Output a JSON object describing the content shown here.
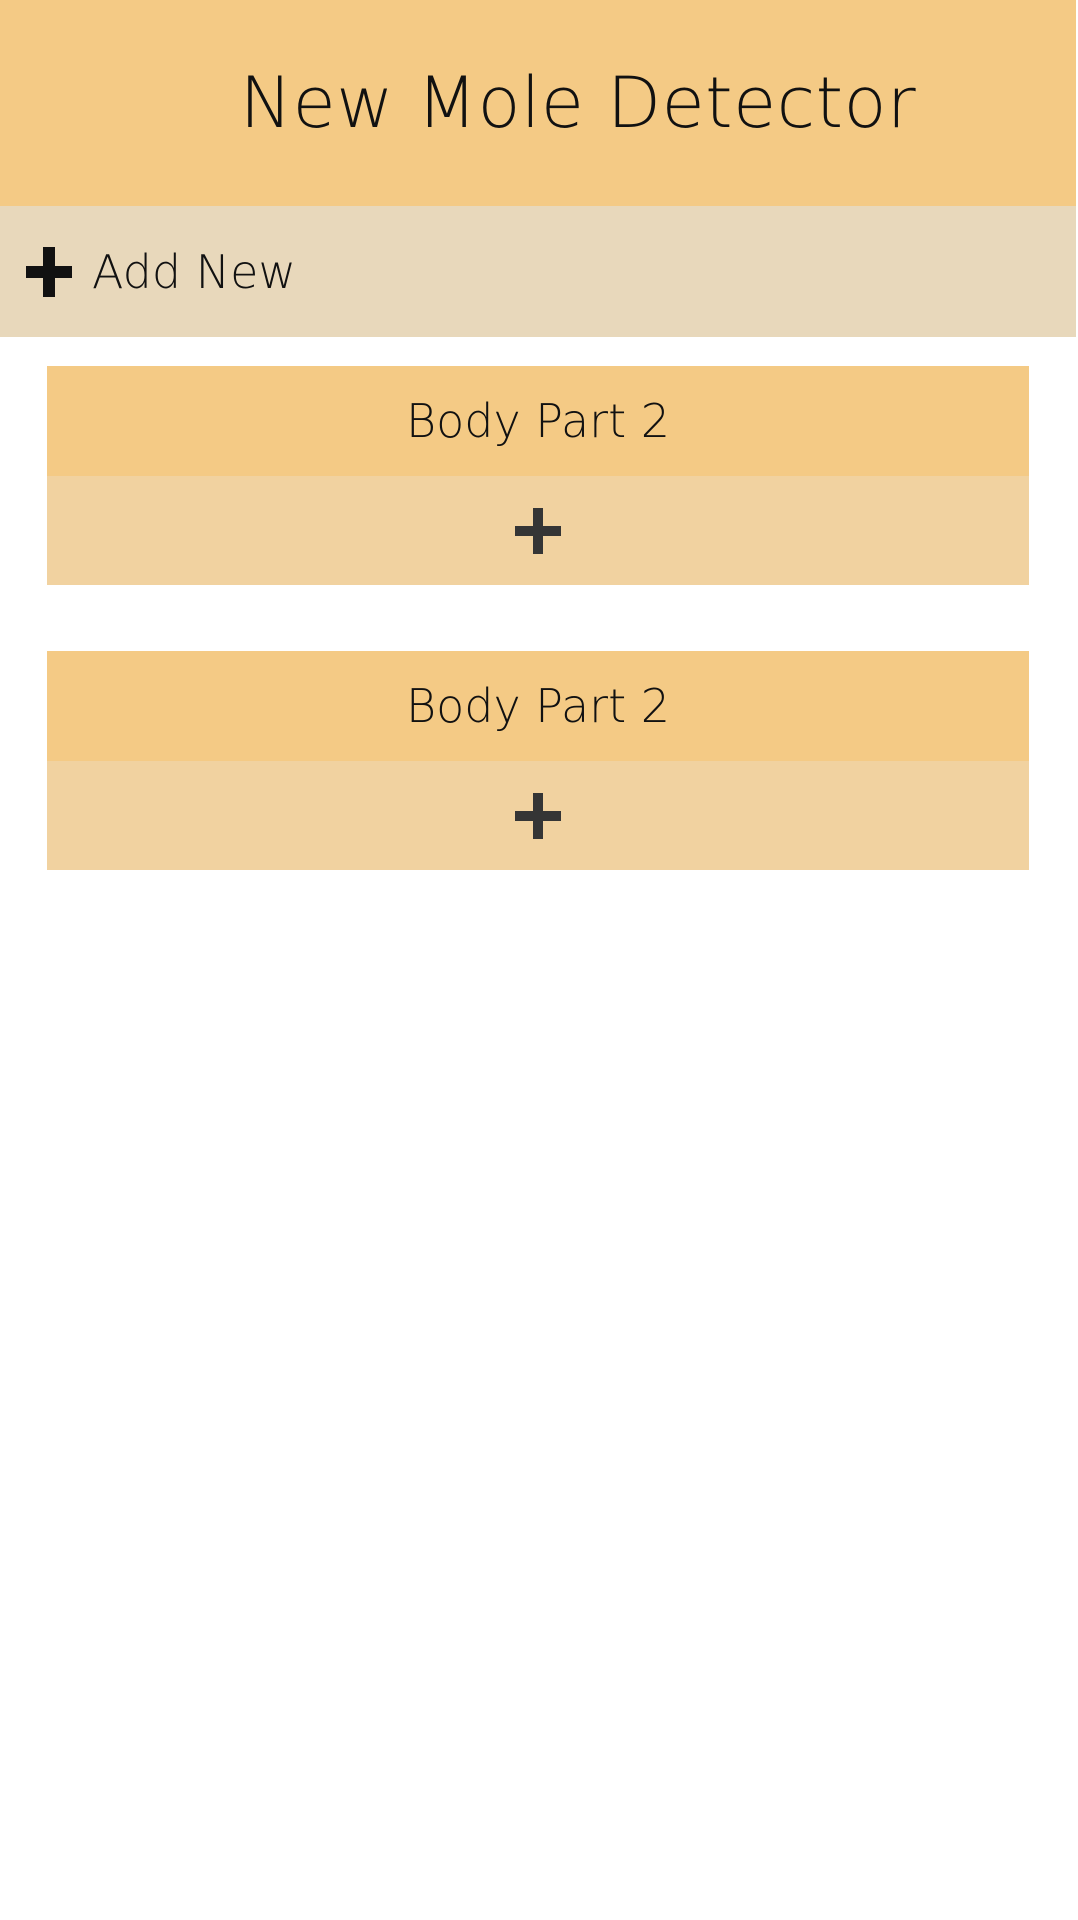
{
  "header": {
    "title": "New Mole Detector"
  },
  "add_new": {
    "label": "Add New",
    "icon": "plus-icon"
  },
  "body_parts": [
    {
      "title": "Body Part 2",
      "add_icon": "plus-icon"
    },
    {
      "title": "Body Part 2",
      "add_icon": "plus-icon"
    }
  ],
  "colors": {
    "header_bg": "#f4ca85",
    "add_new_bg": "#e8d8bb",
    "card_header_bg": "#f4ca85",
    "card_body_bg": "#f1d2a0",
    "plus_icon": "#353535"
  }
}
